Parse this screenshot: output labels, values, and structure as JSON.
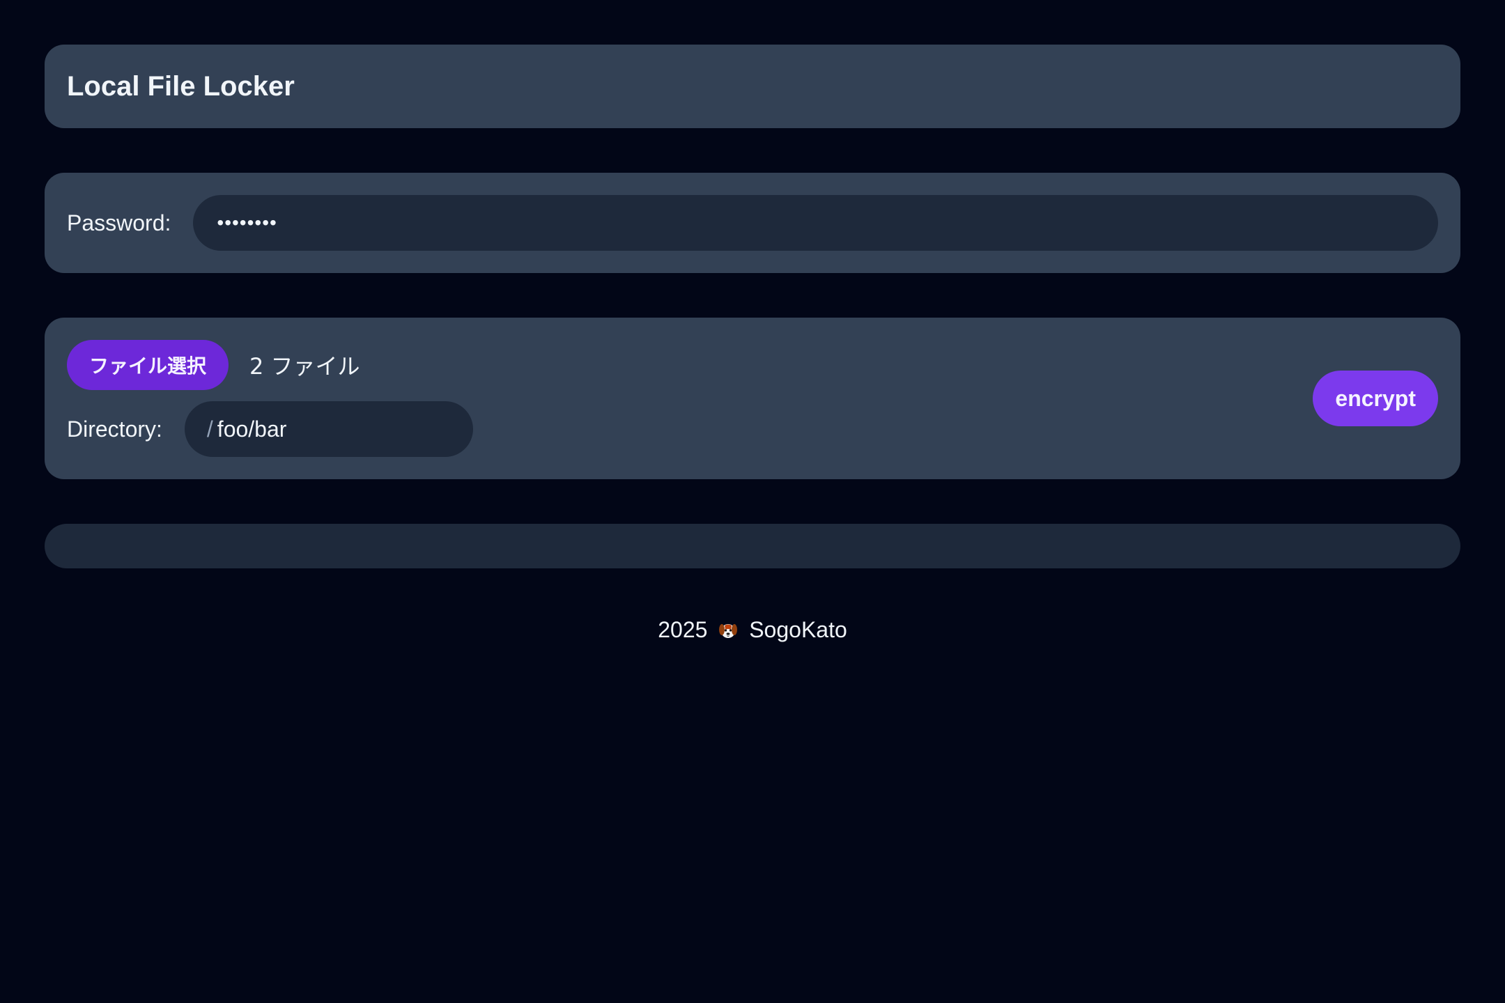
{
  "header": {
    "title": "Local File Locker"
  },
  "password": {
    "label": "Password:",
    "value": "••••••••"
  },
  "files": {
    "select_button_label": "ファイル選択",
    "count_text": "2 ファイル",
    "directory_label": "Directory:",
    "directory_prefix": "/",
    "directory_value": "foo/bar",
    "encrypt_label": "encrypt"
  },
  "footer": {
    "year": "2025",
    "icon": "dog-face-icon",
    "author": "SogoKato"
  },
  "colors": {
    "background": "#020617",
    "card": "#334155",
    "input": "#1e293b",
    "accent": "#7c3aed",
    "accent_dark": "#6d28d9"
  }
}
